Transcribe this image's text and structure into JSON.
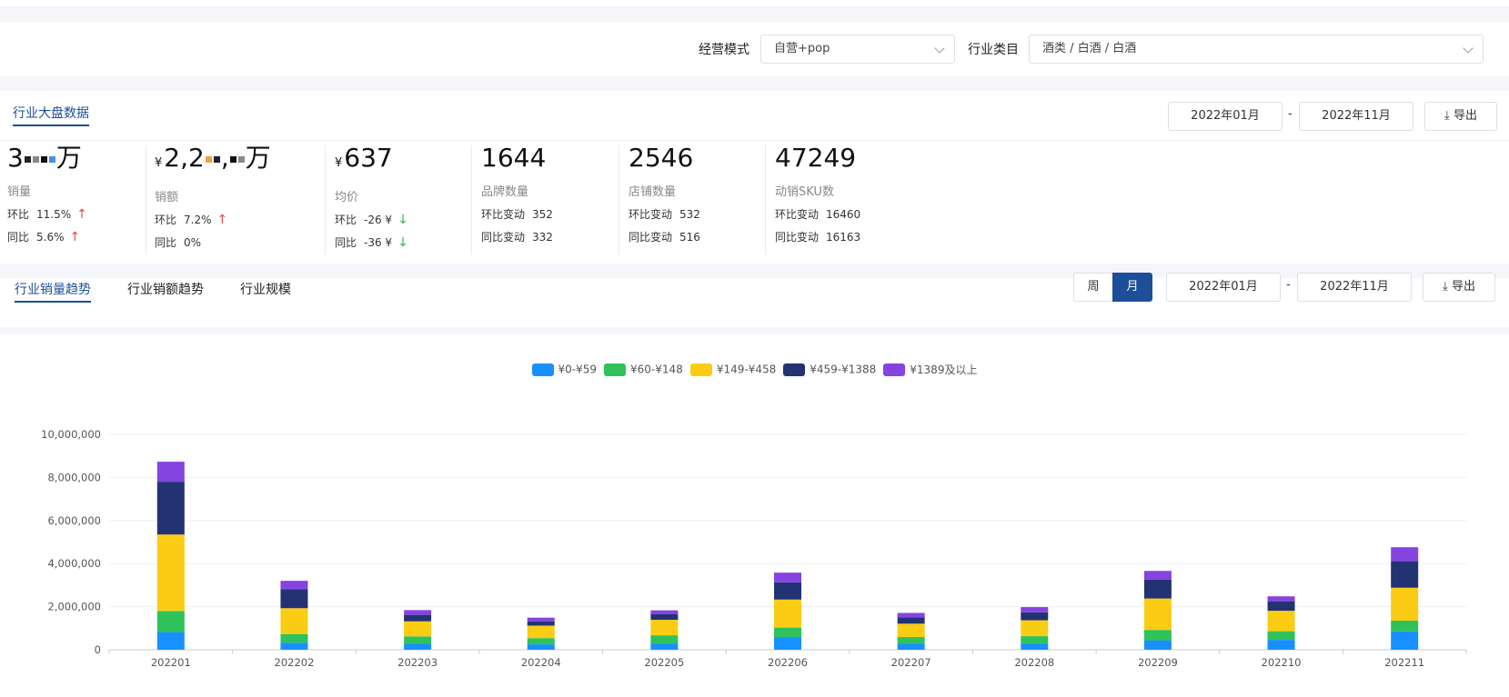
{
  "filters": {
    "mode_label": "经营模式",
    "mode_value": "自营+pop",
    "category_label": "行业类目",
    "category_value": "酒类 / 白酒 / 白酒"
  },
  "overview": {
    "tab_label": "行业大盘数据",
    "date_start": "2022年01月",
    "date_sep": "-",
    "date_end": "2022年11月",
    "export_label": "导出",
    "stats": [
      {
        "value_prefix": "3",
        "value_suffix": "万",
        "name": "销量",
        "r1_k": "环比",
        "r1_v": "11.5%",
        "r2_k": "同比",
        "r2_v": "5.6%"
      },
      {
        "currency": "¥",
        "value_prefix": "2,2",
        "value_mid": ",",
        "value_suffix": "万",
        "name": "销额",
        "r1_k": "环比",
        "r1_v": "7.2%",
        "r2_k": "同比",
        "r2_v": "0%"
      },
      {
        "currency": "¥",
        "value": "637",
        "name": "均价",
        "r1_k": "环比",
        "r1_v": "-26 ¥",
        "r2_k": "同比",
        "r2_v": "-36 ¥"
      },
      {
        "value": "1644",
        "name": "品牌数量",
        "r1_k": "环比变动",
        "r1_v": "352",
        "r2_k": "同比变动",
        "r2_v": "332"
      },
      {
        "value": "2546",
        "name": "店铺数量",
        "r1_k": "环比变动",
        "r1_v": "532",
        "r2_k": "同比变动",
        "r2_v": "516"
      },
      {
        "value": "47249",
        "name": "动销SKU数",
        "r1_k": "环比变动",
        "r1_v": "16460",
        "r2_k": "同比变动",
        "r2_v": "16163"
      }
    ]
  },
  "trend": {
    "tabs": [
      "行业销量趋势",
      "行业销额趋势",
      "行业规模"
    ],
    "toggle_week": "周",
    "toggle_month": "月",
    "date_start": "2022年01月",
    "date_sep": "-",
    "date_end": "2022年11月",
    "export_label": "导出"
  },
  "colors": {
    "accent": "#1d4e99",
    "up": "#e5484d",
    "down": "#2dbb59"
  },
  "chart_data": {
    "type": "bar",
    "stacked": true,
    "categories": [
      "202201",
      "202202",
      "202203",
      "202204",
      "202205",
      "202206",
      "202207",
      "202208",
      "202209",
      "202210",
      "202211"
    ],
    "series": [
      {
        "name": "¥0-¥59",
        "color": "#1890ff",
        "values": [
          820000,
          330000,
          290000,
          250000,
          290000,
          570000,
          290000,
          290000,
          440000,
          460000,
          850000
        ]
      },
      {
        "name": "¥60-¥148",
        "color": "#2fc25b",
        "values": [
          980000,
          400000,
          330000,
          290000,
          380000,
          460000,
          300000,
          340000,
          480000,
          400000,
          500000
        ]
      },
      {
        "name": "¥149-¥458",
        "color": "#facc14",
        "values": [
          3550000,
          1200000,
          700000,
          580000,
          720000,
          1300000,
          620000,
          740000,
          1460000,
          950000,
          1530000
        ]
      },
      {
        "name": "¥459-¥1388",
        "color": "#223273",
        "values": [
          2450000,
          880000,
          300000,
          200000,
          270000,
          800000,
          300000,
          370000,
          880000,
          440000,
          1230000
        ]
      },
      {
        "name": "¥1389及以上",
        "color": "#8543e0",
        "values": [
          930000,
          390000,
          220000,
          170000,
          170000,
          450000,
          200000,
          240000,
          400000,
          230000,
          650000
        ]
      }
    ],
    "ylim": [
      0,
      10000000
    ],
    "yticks": [
      "0",
      "2,000,000",
      "4,000,000",
      "6,000,000",
      "8,000,000",
      "10,000,000"
    ],
    "grid": true,
    "legend_position": "top"
  }
}
